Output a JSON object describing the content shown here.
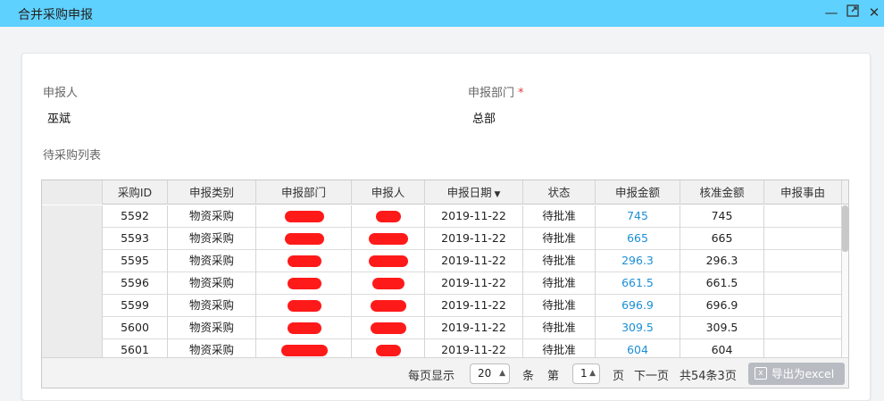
{
  "window": {
    "title": "合并采购申报",
    "minimize_icon": "minimize-icon",
    "maximize_icon": "maximize-icon",
    "close_icon": "close-icon"
  },
  "form": {
    "applicant_label": "申报人",
    "applicant_value": "巫斌",
    "dept_label": "申报部门",
    "dept_required": "*",
    "dept_value": "总部",
    "list_title": "待采购列表"
  },
  "table": {
    "headers": [
      "采购ID",
      "申报类别",
      "申报部门",
      "申报人",
      "申报日期",
      "状态",
      "申报金额",
      "核准金额",
      "申报事由"
    ],
    "sort_column": "申报日期",
    "rows": [
      {
        "id": "5592",
        "category": "物资采购",
        "date": "2019-11-22",
        "status": "待批准",
        "amount": "745",
        "approved": "745"
      },
      {
        "id": "5593",
        "category": "物资采购",
        "date": "2019-11-22",
        "status": "待批准",
        "amount": "665",
        "approved": "665"
      },
      {
        "id": "5595",
        "category": "物资采购",
        "date": "2019-11-22",
        "status": "待批准",
        "amount": "296.3",
        "approved": "296.3"
      },
      {
        "id": "5596",
        "category": "物资采购",
        "date": "2019-11-22",
        "status": "待批准",
        "amount": "661.5",
        "approved": "661.5"
      },
      {
        "id": "5599",
        "category": "物资采购",
        "date": "2019-11-22",
        "status": "待批准",
        "amount": "696.9",
        "approved": "696.9"
      },
      {
        "id": "5600",
        "category": "物资采购",
        "date": "2019-11-22",
        "status": "待批准",
        "amount": "309.5",
        "approved": "309.5"
      },
      {
        "id": "5601",
        "category": "物资采购",
        "date": "2019-11-22",
        "status": "待批准",
        "amount": "604",
        "approved": "604"
      }
    ]
  },
  "pager": {
    "per_page_label": "每页显示",
    "per_page_value": "20",
    "per_page_unit": "条",
    "page_prefix": "第",
    "page_value": "1",
    "page_suffix": "页",
    "next_label": "下一页",
    "summary": "共54条3页",
    "export_label": "导出为excel",
    "export_icon_glyph": "x"
  },
  "colors": {
    "titlebar": "#5fd1ff",
    "link": "#1a8fd6",
    "redaction": "#ff1a1a",
    "required": "#e23b3b"
  }
}
